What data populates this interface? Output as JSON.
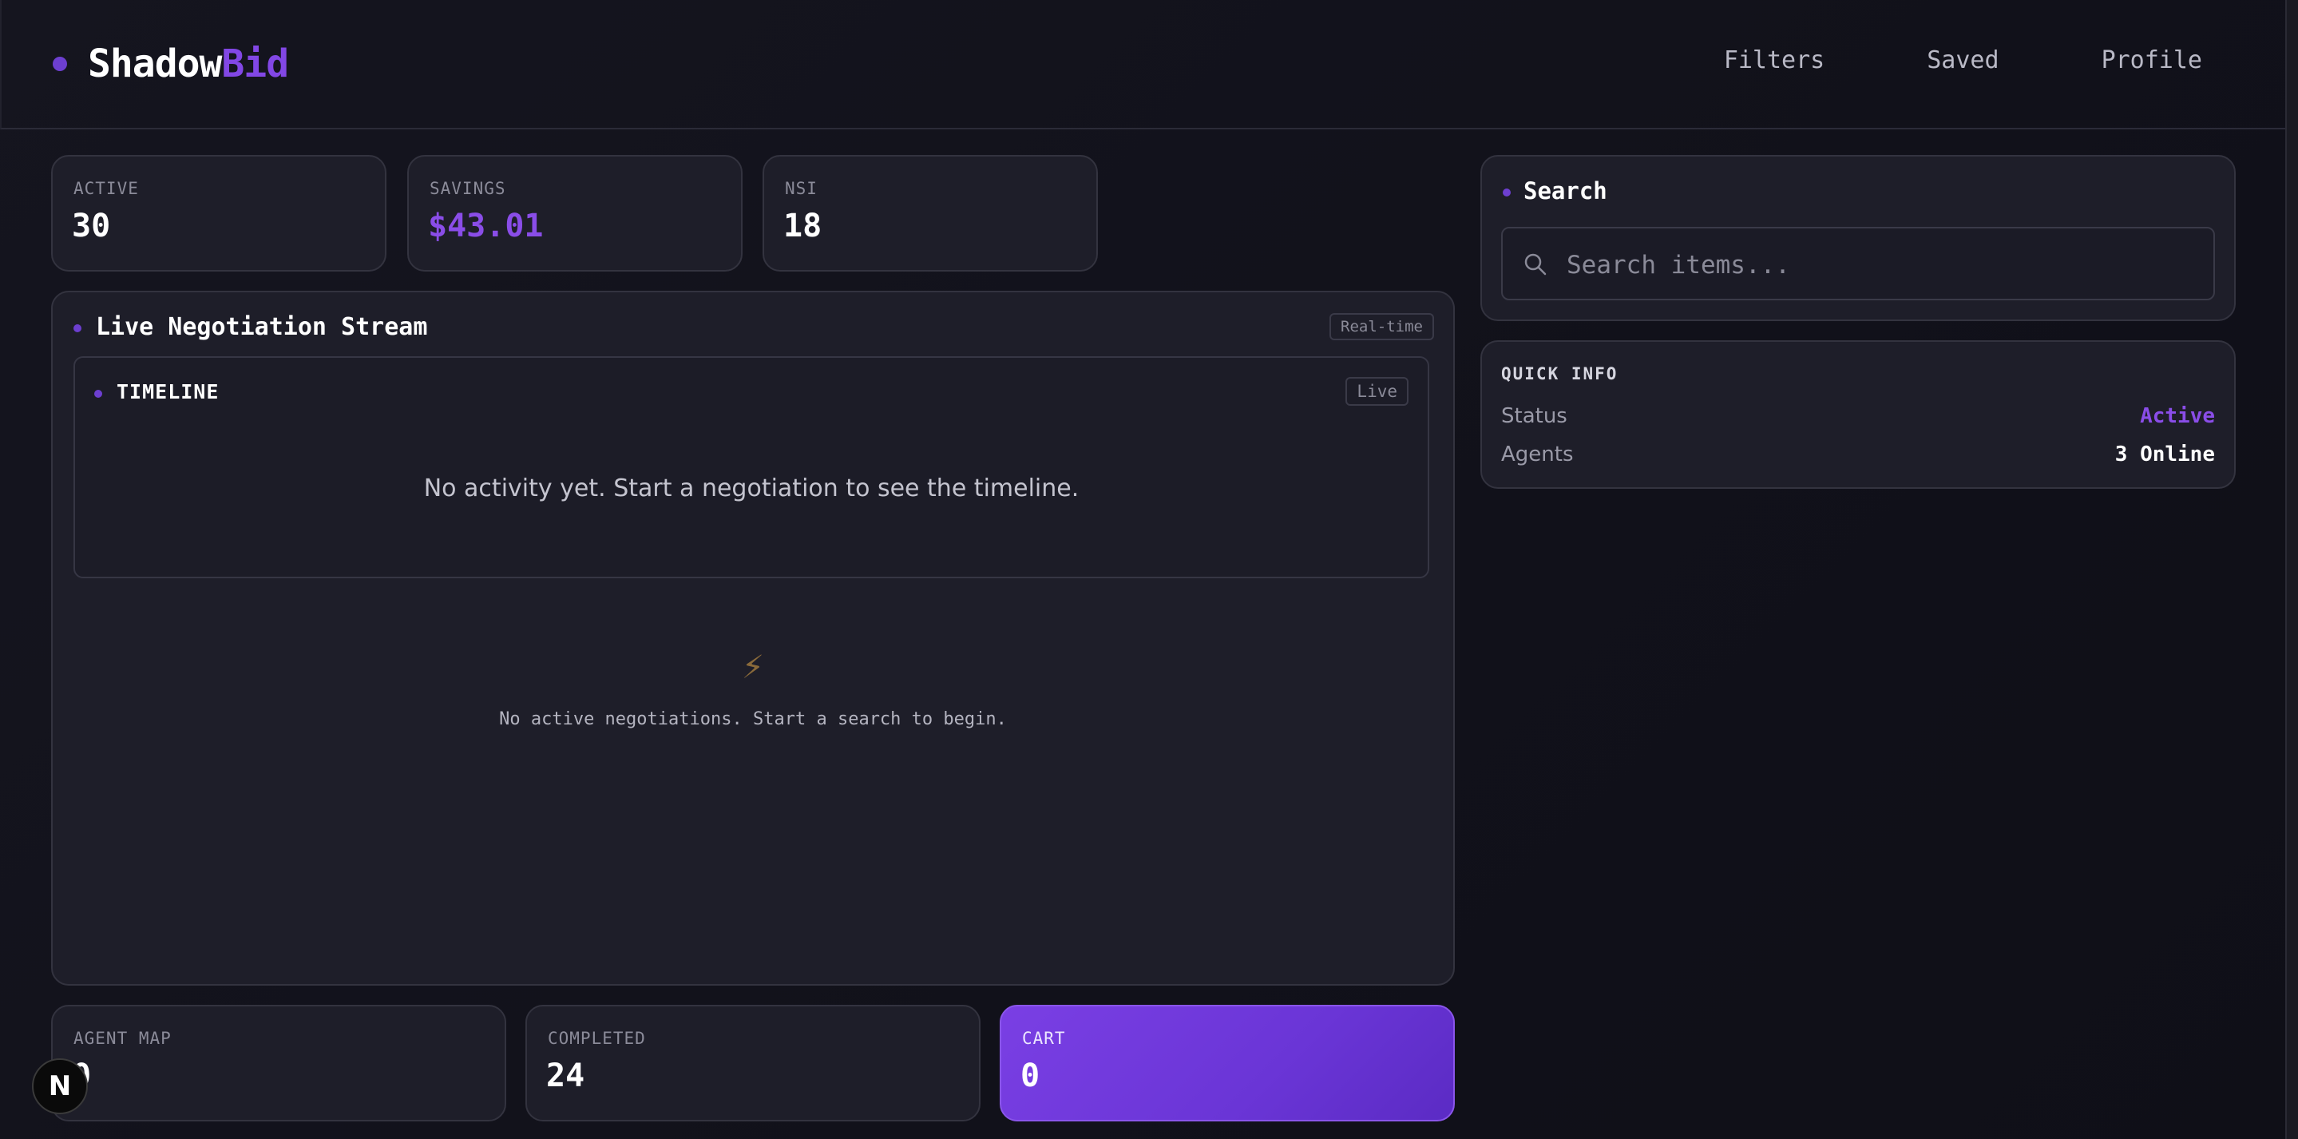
{
  "header": {
    "logo_main": "Shadow",
    "logo_accent": "Bid",
    "nav": [
      "Filters",
      "Saved",
      "Profile"
    ]
  },
  "stats_top": [
    {
      "label": "ACTIVE",
      "value": "30"
    },
    {
      "label": "SAVINGS",
      "value": "$43.01"
    },
    {
      "label": "NSI",
      "value": "18"
    }
  ],
  "stream": {
    "title": "Live Negotiation Stream",
    "tag": "Real-time",
    "timeline": {
      "title": "TIMELINE",
      "tag": "Live",
      "empty": "No activity yet. Start a negotiation to see the timeline."
    },
    "bolt_icon": "⚡",
    "empty": "No active negotiations. Start a search to begin."
  },
  "stats_bottom": [
    {
      "label": "AGENT MAP",
      "value": "0"
    },
    {
      "label": "COMPLETED",
      "value": "24"
    },
    {
      "label": "CART",
      "value": "0"
    }
  ],
  "search": {
    "title": "Search",
    "placeholder": "Search items..."
  },
  "quick_info": {
    "title": "QUICK INFO",
    "rows": [
      {
        "key": "Status",
        "value": "Active"
      },
      {
        "key": "Agents",
        "value": "3 Online"
      }
    ]
  },
  "badge": {
    "letter": "N"
  },
  "colors": {
    "accent": "#8247e5",
    "background": "#12121a",
    "card": "#1e1e29"
  }
}
